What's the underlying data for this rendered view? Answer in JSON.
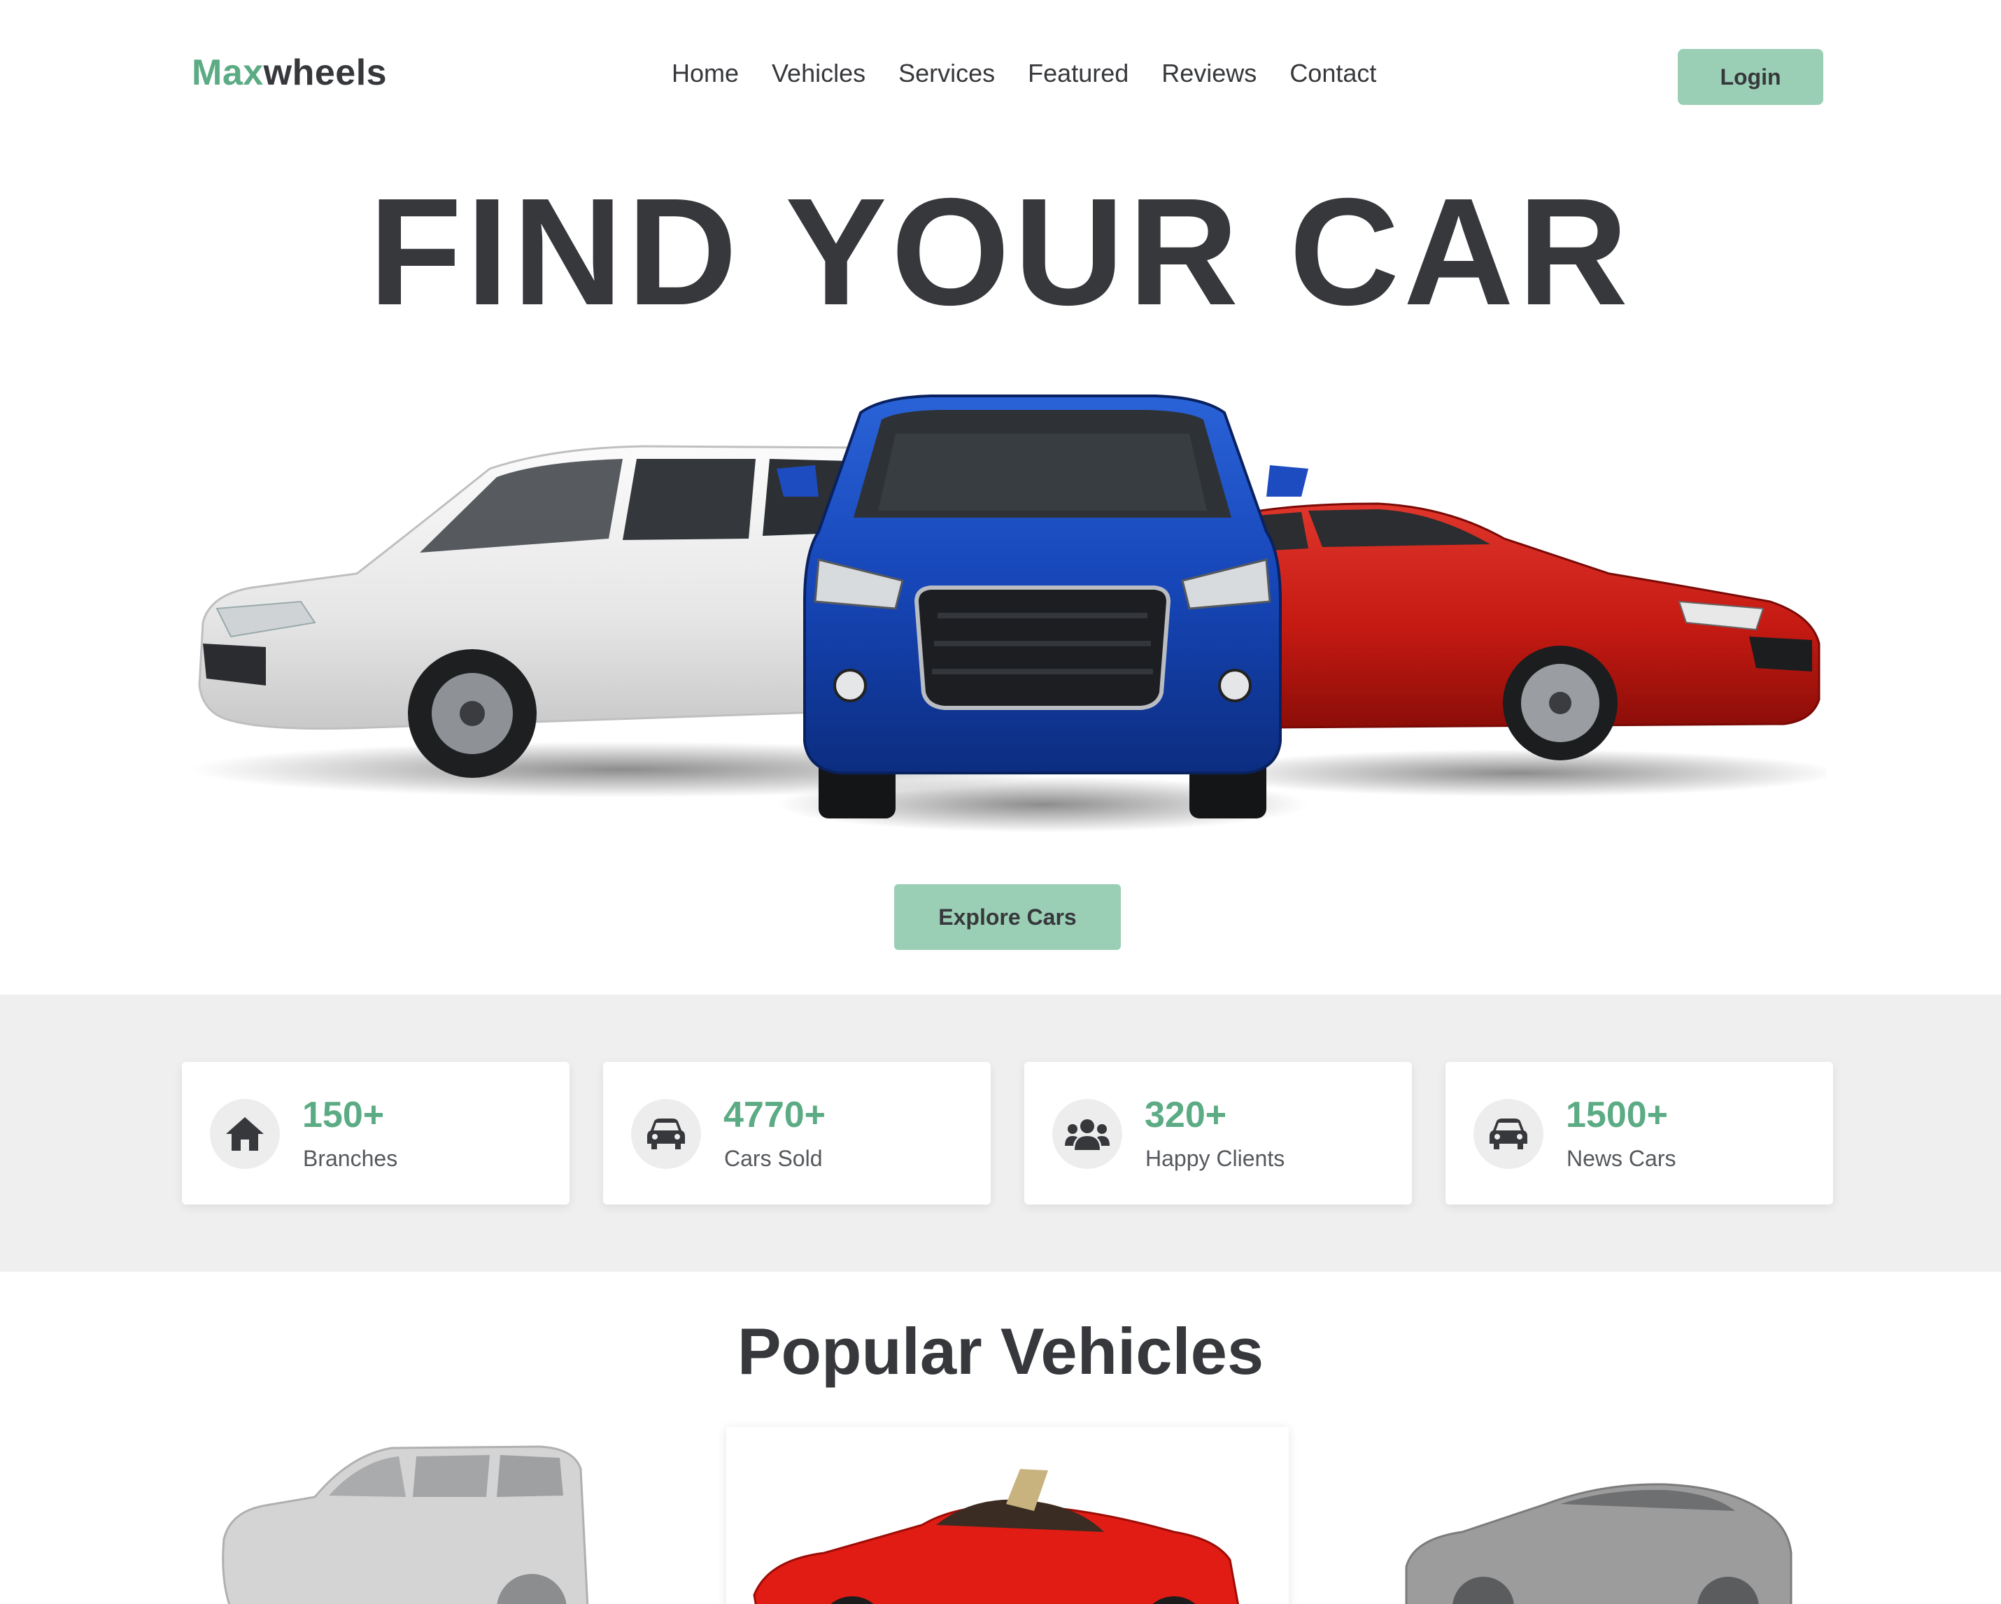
{
  "brand": {
    "accent": "Max",
    "rest": "wheels",
    "accent_color": "#5bab84"
  },
  "nav": {
    "items": [
      {
        "label": "Home"
      },
      {
        "label": "Vehicles"
      },
      {
        "label": "Services"
      },
      {
        "label": "Featured"
      },
      {
        "label": "Reviews"
      },
      {
        "label": "Contact"
      }
    ]
  },
  "header": {
    "login_label": "Login",
    "button_color": "#9bcfb5"
  },
  "hero": {
    "title": "FIND YOUR CAR",
    "cars": [
      "white-suv",
      "blue-suv",
      "red-sedan"
    ],
    "cta_label": "Explore Cars"
  },
  "stats": [
    {
      "icon": "home-icon",
      "value": "150+",
      "label": "Branches"
    },
    {
      "icon": "car-icon",
      "value": "4770+",
      "label": "Cars Sold"
    },
    {
      "icon": "users-icon",
      "value": "320+",
      "label": "Happy Clients"
    },
    {
      "icon": "car-icon",
      "value": "1500+",
      "label": "News Cars"
    }
  ],
  "popular": {
    "title_plain": "Popular",
    "title_highlight": "Vehicles",
    "vehicles": [
      {
        "image": "silver-suv",
        "active": false
      },
      {
        "image": "red-convertible",
        "active": true
      },
      {
        "image": "silver-sedan",
        "active": false
      }
    ]
  }
}
